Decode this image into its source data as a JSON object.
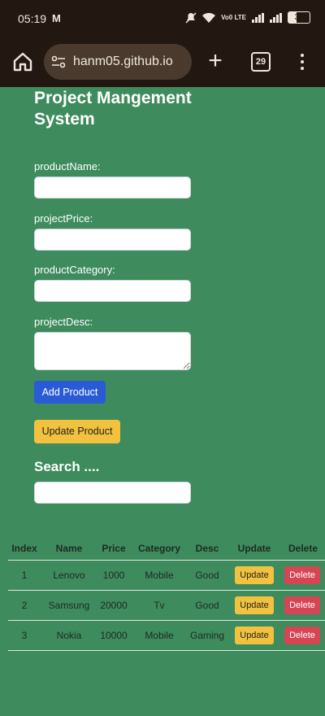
{
  "status_bar": {
    "time": "05:19",
    "battery": "39",
    "network": "Vo0 LTE"
  },
  "browser": {
    "url": "hanm05.github.io",
    "tab_count": "29"
  },
  "page": {
    "title": "Project Mangement System",
    "labels": {
      "product_name": "productName:",
      "project_price": "projectPrice:",
      "product_category": "productCategory:",
      "project_desc": "projectDesc:"
    },
    "inputs": {
      "product_name": "",
      "project_price": "",
      "product_category": "",
      "project_desc": "",
      "search": ""
    },
    "add_button": "Add Product",
    "update_button": "Update Product",
    "search_heading": "Search ....",
    "table": {
      "headers": [
        "Index",
        "Name",
        "Price",
        "Category",
        "Desc",
        "Update",
        "Delete"
      ],
      "rows": [
        {
          "index": "1",
          "name": "Lenovo",
          "price": "1000",
          "category": "Mobile",
          "desc": "Good",
          "update": "Update",
          "delete": "Delete"
        },
        {
          "index": "2",
          "name": "Samsung",
          "price": "20000",
          "category": "Tv",
          "desc": "Good",
          "update": "Update",
          "delete": "Delete"
        },
        {
          "index": "3",
          "name": "Nokia",
          "price": "10000",
          "category": "Mobile",
          "desc": "Gaming",
          "update": "Update",
          "delete": "Delete"
        }
      ]
    }
  },
  "colors": {
    "background": "#3e8b5d",
    "primary": "#2a5bd7",
    "warning": "#f2c23e",
    "danger": "#d64554",
    "chrome": "#221811"
  }
}
